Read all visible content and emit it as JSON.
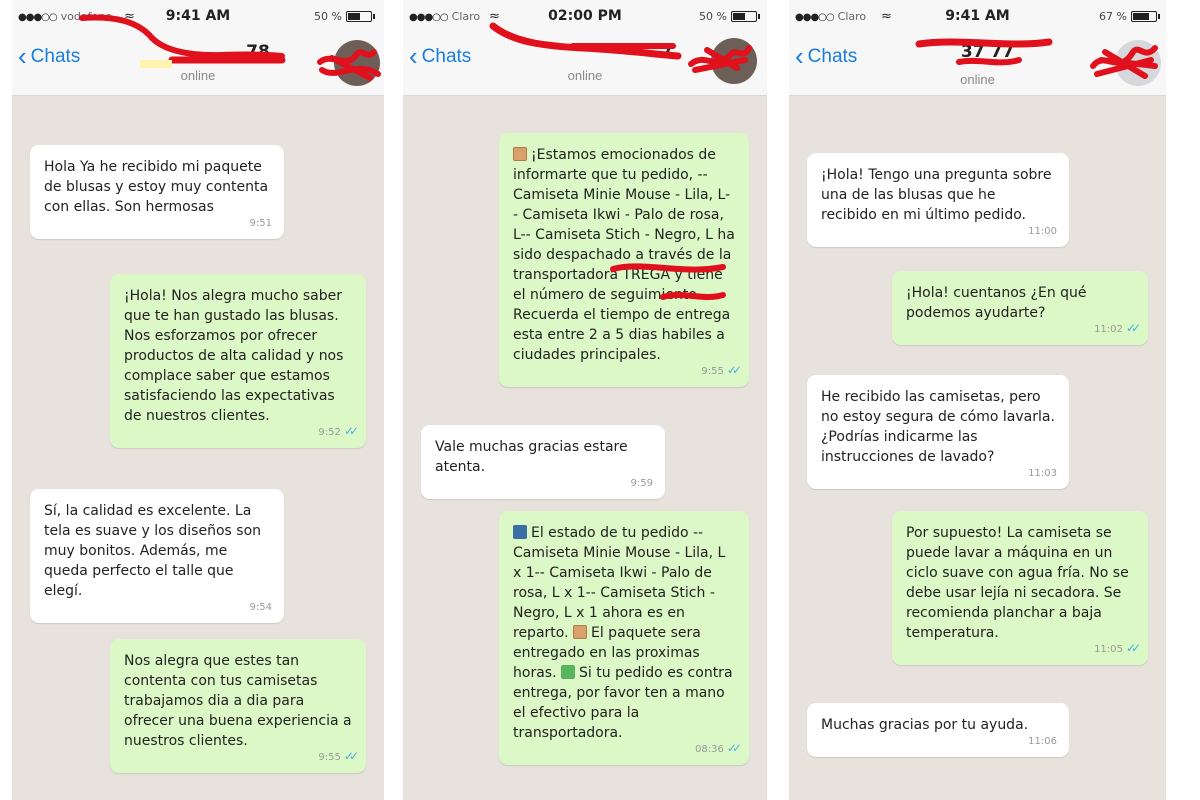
{
  "phones": [
    {
      "status": {
        "carrier": "vodafone",
        "time": "9:41 AM",
        "battery": "50 %",
        "battery_level": 0.5
      },
      "nav": {
        "back_label": "Chats",
        "contact_visible": "78",
        "subtitle": "online"
      },
      "messages": [
        {
          "dir": "in",
          "text": "Hola Ya he recibido mi paquete de blusas y estoy muy contenta con ellas. Son hermosas",
          "time": "9:51"
        },
        {
          "dir": "out",
          "text": "¡Hola! Nos alegra mucho saber que te han gustado las blusas. Nos esforzamos por ofrecer productos de alta calidad y nos complace saber que estamos satisfaciendo las expectativas de nuestros clientes.",
          "time": "9:52",
          "ticks": "✓✓"
        },
        {
          "dir": "in",
          "text": "Sí, la calidad es excelente. La tela es suave y los diseños son muy bonitos. Además, me queda perfecto el talle que elegí.",
          "time": "9:54"
        },
        {
          "dir": "out",
          "text": "Nos alegra que estes tan contenta con tus camisetas trabajamos dia a dia para ofrecer una buena experiencia a nuestros clientes.",
          "time": "9:55",
          "ticks": "✓✓"
        }
      ]
    },
    {
      "status": {
        "carrier": "Claro",
        "time": "02:00 PM",
        "battery": "50 %",
        "battery_level": 0.5
      },
      "nav": {
        "back_label": "Chats",
        "contact_visible": "7",
        "subtitle": "online"
      },
      "messages": [
        {
          "dir": "out",
          "text": "¡Estamos emocionados de informarte que tu pedido, -- Camiseta Minie Mouse - Lila, L-- Camiseta Ikwi - Palo de rosa, L-- Camiseta Stich - Negro, L ha sido despachado a través de la transportadora TREGA y tiene el número de seguimiento. Recuerda el tiempo de entrega esta entre 2 a 5 dias habiles a ciudades principales.",
          "time": "9:55",
          "ticks": "✓✓",
          "icon": "package-icon"
        },
        {
          "dir": "in",
          "text": "Vale muchas gracias estare atenta.",
          "time": "9:59"
        },
        {
          "dir": "out",
          "text_a": "El estado de tu pedido -- Camiseta Minie Mouse - Lila, L x 1-- Camiseta Ikwi - Palo de rosa, L x 1-- Camiseta Stich - Negro, L x 1 ahora es en reparto.",
          "text_b": "El paquete sera entregado en las proximas horas.",
          "text_c": "Si tu pedido es contra entrega, por favor ten a mano el efectivo para la transportadora.",
          "time": "08:36",
          "ticks": "✓✓"
        }
      ]
    },
    {
      "status": {
        "carrier": "Claro",
        "time": "9:41 AM",
        "battery": "67 %",
        "battery_level": 0.67
      },
      "nav": {
        "back_label": "Chats",
        "contact_visible": "37 77",
        "subtitle": "online"
      },
      "messages": [
        {
          "dir": "in",
          "text": "¡Hola! Tengo una pregunta sobre una de las blusas que he recibido en mi último pedido.",
          "time": "11:00"
        },
        {
          "dir": "out",
          "text": "¡Hola! cuentanos ¿En qué podemos ayudarte?",
          "time": "11:02",
          "ticks": "✓✓"
        },
        {
          "dir": "in",
          "text": "He recibido las camisetas, pero no estoy segura de cómo lavarla. ¿Podrías indicarme las instrucciones de lavado?",
          "time": "11:03"
        },
        {
          "dir": "out",
          "text": "Por supuesto! La camiseta se puede lavar a máquina en un ciclo suave con agua fría. No se debe usar lejía ni secadora. Se recomienda planchar a baja temperatura.",
          "time": "11:05",
          "ticks": "✓✓"
        },
        {
          "dir": "in",
          "text": "Muchas gracias por tu ayuda.",
          "time": "11:06"
        }
      ]
    }
  ],
  "colors": {
    "accent": "#1a7de0",
    "outgoing": "#dcf8c6",
    "incoming": "#ffffff",
    "background": "#e7e2dc",
    "redaction": "#e0101c",
    "read_ticks": "#4fb1e8"
  }
}
